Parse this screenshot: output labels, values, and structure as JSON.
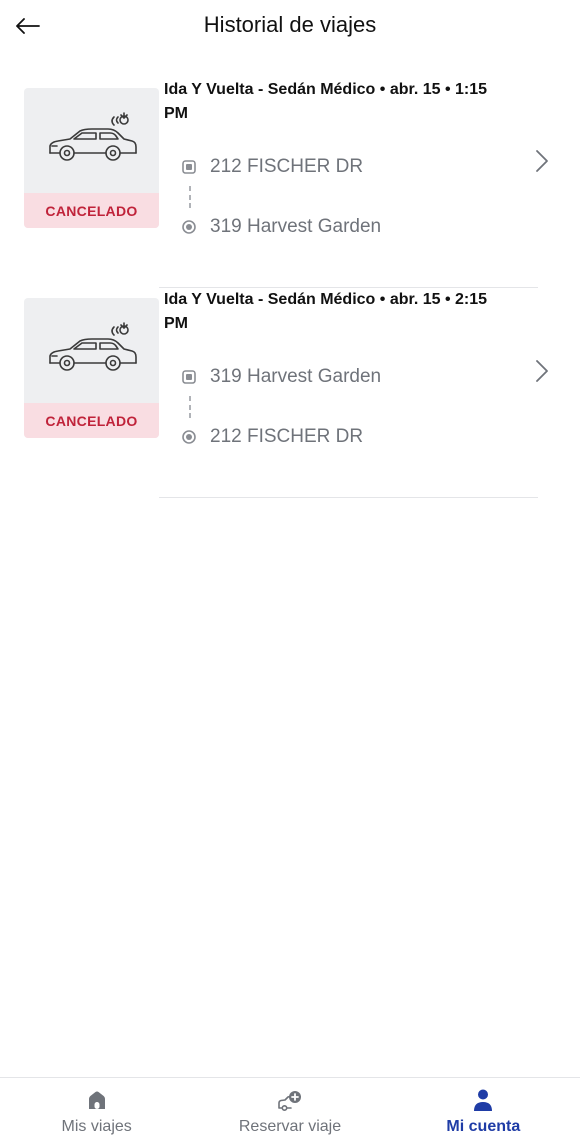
{
  "header": {
    "title": "Historial de viajes",
    "back_icon": "arrow-left-icon"
  },
  "trips": [
    {
      "title": "Ida Y Vuelta - Sedán Médico • abr. 15 • 1:15 PM",
      "status": "CANCELADO",
      "origin": "212 FISCHER DR",
      "destination": "319 Harvest Garden",
      "icon": "medical-sedan-icon"
    },
    {
      "title": "Ida Y Vuelta - Sedán Médico • abr. 15 • 2:15 PM",
      "status": "CANCELADO",
      "origin": "319 Harvest Garden",
      "destination": "212 FISCHER DR",
      "icon": "medical-sedan-icon"
    }
  ],
  "tabbar": {
    "tabs": [
      {
        "label": "Mis viajes",
        "icon": "home-icon",
        "active": false
      },
      {
        "label": "Reservar viaje",
        "icon": "book-ride-icon",
        "active": false
      },
      {
        "label": "Mi cuenta",
        "icon": "user-icon",
        "active": true
      }
    ]
  },
  "colors": {
    "status_bg": "#f9dde2",
    "status_text": "#c0233a",
    "muted_text": "#6f737a",
    "tab_inactive": "#6f737a",
    "tab_active": "#1f3ca6",
    "thumb_bg": "#eeeff1"
  }
}
